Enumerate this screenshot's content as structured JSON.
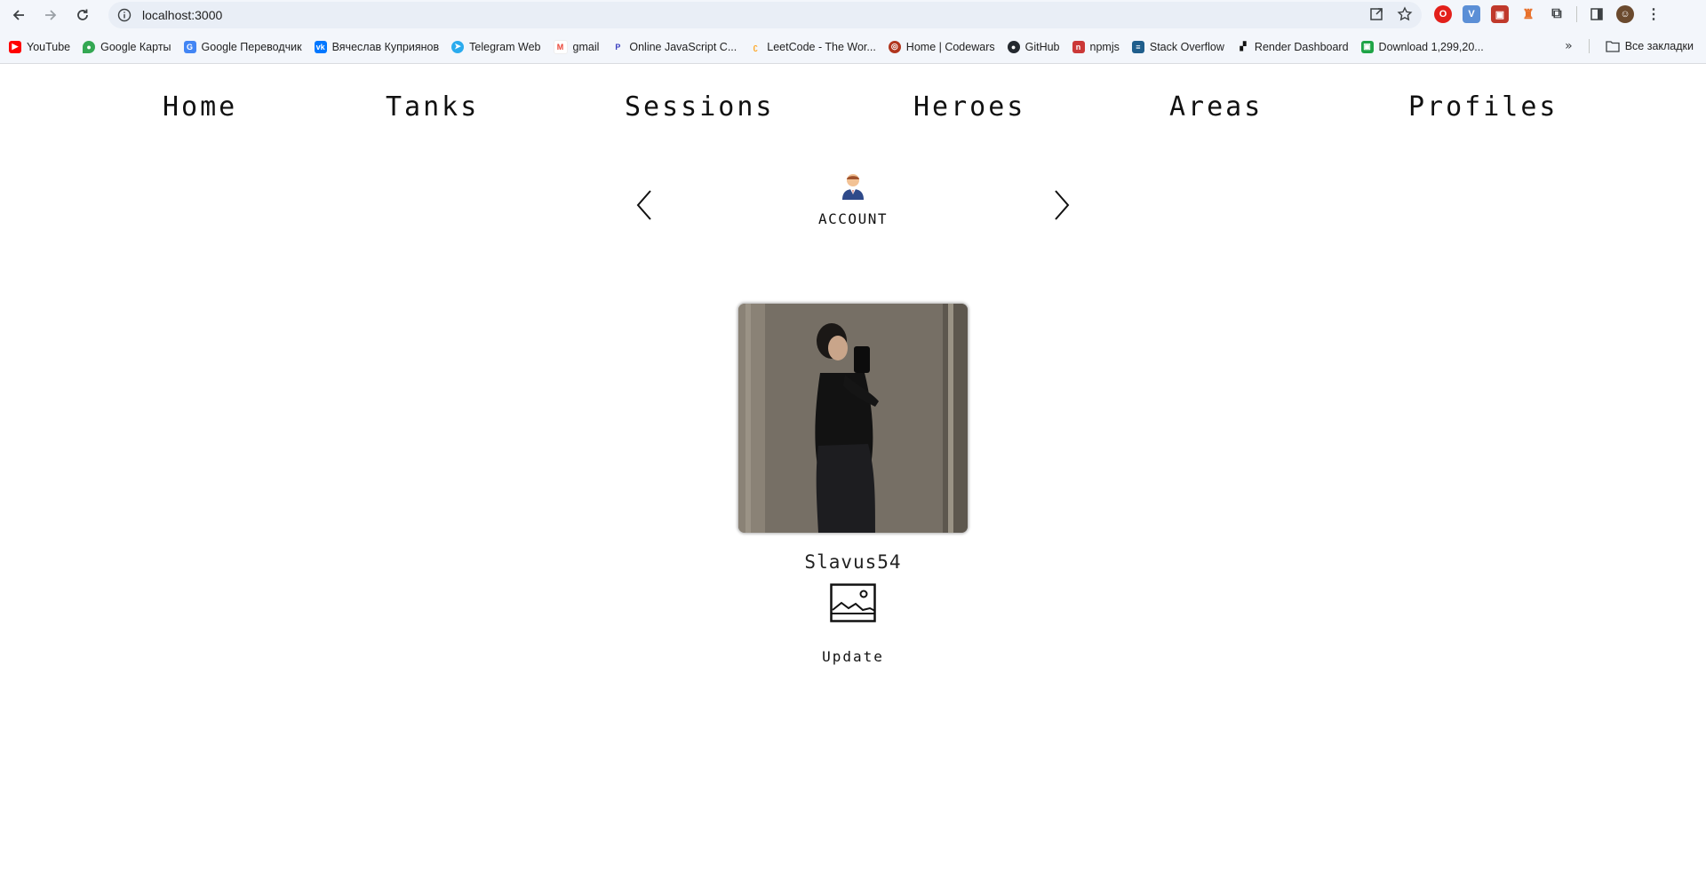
{
  "browser": {
    "url": "localhost:3000",
    "bookmarks": [
      {
        "label": "YouTube",
        "icon": "youtube-icon",
        "color": "#ff0000"
      },
      {
        "label": "Google Карты",
        "icon": "google-maps-icon",
        "color": "#34a853"
      },
      {
        "label": "Google Переводчик",
        "icon": "google-translate-icon",
        "color": "#4285f4"
      },
      {
        "label": "Вячеслав Куприянов",
        "icon": "vk-icon",
        "color": "#0077ff"
      },
      {
        "label": "Telegram Web",
        "icon": "telegram-icon",
        "color": "#2aabee"
      },
      {
        "label": "gmail",
        "icon": "gmail-icon",
        "color": "#ea4335"
      },
      {
        "label": "Online JavaScript C...",
        "icon": "js-icon",
        "color": "#3b3fbf"
      },
      {
        "label": "LeetCode - The Wor...",
        "icon": "leetcode-icon",
        "color": "#ffa116"
      },
      {
        "label": "Home | Codewars",
        "icon": "codewars-icon",
        "color": "#b1361e"
      },
      {
        "label": "GitHub",
        "icon": "github-icon",
        "color": "#24292f"
      },
      {
        "label": "npmjs",
        "icon": "npm-icon",
        "color": "#cb3837"
      },
      {
        "label": "Stack Overflow",
        "icon": "stackoverflow-icon",
        "color": "#f48024"
      },
      {
        "label": "Render Dashboard",
        "icon": "render-icon",
        "color": "#111111"
      },
      {
        "label": "Download 1,299,20...",
        "icon": "download-icon",
        "color": "#1ea446"
      }
    ],
    "all_bookmarks_label": "Все закладки"
  },
  "nav": {
    "items": [
      "Home",
      "Tanks",
      "Sessions",
      "Heroes",
      "Areas",
      "Profiles"
    ]
  },
  "carousel": {
    "icon": "businessman-emoji-icon",
    "label": "ACCOUNT"
  },
  "profile": {
    "username": "Slavus54",
    "update_label": "Update"
  }
}
